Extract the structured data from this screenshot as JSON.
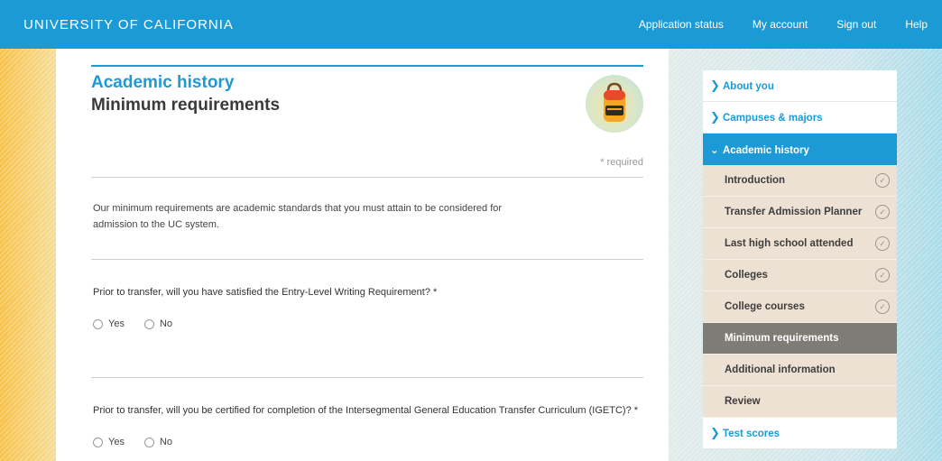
{
  "header": {
    "brand": "UNIVERSITY OF CALIFORNIA",
    "nav": [
      "Application status",
      "My account",
      "Sign out",
      "Help"
    ]
  },
  "main": {
    "section_title": "Academic history",
    "subtitle": "Minimum requirements",
    "required_note": "* required",
    "intro": "Our minimum requirements are academic standards that you must attain to be considered for admission to the UC system.",
    "questions": [
      {
        "text": "Prior to transfer, will you have satisfied the Entry-Level Writing Requirement? *",
        "options": [
          "Yes",
          "No"
        ]
      },
      {
        "text": "Prior to transfer, will you be certified for completion of the Intersegmental General Education Transfer Curriculum (IGETC)? *",
        "options": [
          "Yes",
          "No"
        ]
      }
    ]
  },
  "sidebar": {
    "top_items": [
      "About you",
      "Campuses & majors"
    ],
    "active_section": "Academic history",
    "sub_items": [
      {
        "label": "Introduction",
        "done": true
      },
      {
        "label": "Transfer Admission Planner",
        "done": true
      },
      {
        "label": "Last high school attended",
        "done": true
      },
      {
        "label": "Colleges",
        "done": true
      },
      {
        "label": "College courses",
        "done": true
      },
      {
        "label": "Minimum requirements",
        "done": false,
        "current": true
      },
      {
        "label": "Additional information",
        "done": false
      },
      {
        "label": "Review",
        "done": false
      }
    ],
    "bottom_items": [
      "Test scores"
    ]
  },
  "colors": {
    "brand_blue": "#1c9ad6",
    "current_item_bg": "#7f7b75",
    "sub_item_bg": "#ece1d2"
  },
  "icons": {
    "section_icon": "backpack-icon",
    "chevron_collapsed": "chevron-right-icon",
    "chevron_expanded": "chevron-down-icon",
    "completed": "check-circle-icon"
  }
}
